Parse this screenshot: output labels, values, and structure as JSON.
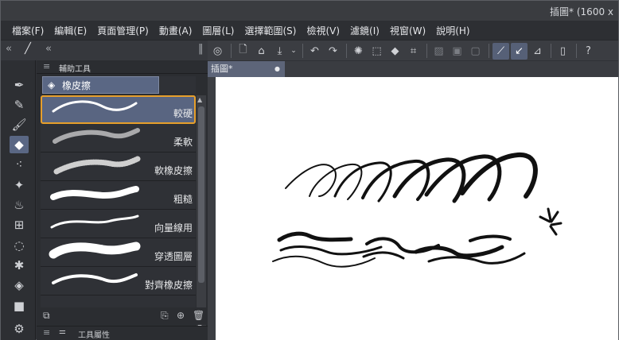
{
  "window": {
    "title": "插圖* (1600 x"
  },
  "menu": [
    "檔案(F)",
    "編輯(E)",
    "頁面管理(P)",
    "動畫(A)",
    "圖層(L)",
    "選擇範圍(S)",
    "檢視(V)",
    "濾鏡(I)",
    "視窗(W)",
    "說明(H)"
  ],
  "panel": {
    "title": "輔助工具",
    "group_label": "橡皮擦",
    "footer_title": "工具屬性",
    "items": [
      {
        "label": "較硬",
        "selected": true
      },
      {
        "label": "柔軟"
      },
      {
        "label": "軟橡皮擦"
      },
      {
        "label": "粗糙"
      },
      {
        "label": "向量線用"
      },
      {
        "label": "穿透圖層"
      },
      {
        "label": "對齊橡皮擦"
      }
    ]
  },
  "document": {
    "tab_label": "插圖*"
  },
  "icons": {
    "tools": [
      "pen-icon",
      "pencil-icon",
      "brush-icon",
      "eraser-icon",
      "spray-icon",
      "sparkle-icon",
      "blend-icon",
      "grid-icon",
      "lasso-icon",
      "wand-icon",
      "fill-icon",
      "gradient-icon",
      "figure-icon"
    ],
    "toolbar": [
      "clip-studio-icon",
      "new-file-icon",
      "open-folder-icon",
      "save-icon",
      "undo-icon",
      "redo-icon",
      "loading-icon",
      "clear-icon",
      "fill-icon",
      "transform-icon",
      "snap-1-icon",
      "snap-2-icon",
      "snap-3-icon",
      "ruler-snap-icon",
      "vector-snap-icon",
      "perspective-icon",
      "smartphone-icon",
      "help-icon"
    ]
  },
  "colors": {
    "accent": "#e79f2b",
    "selection": "#596581",
    "panel": "#2f3136"
  }
}
